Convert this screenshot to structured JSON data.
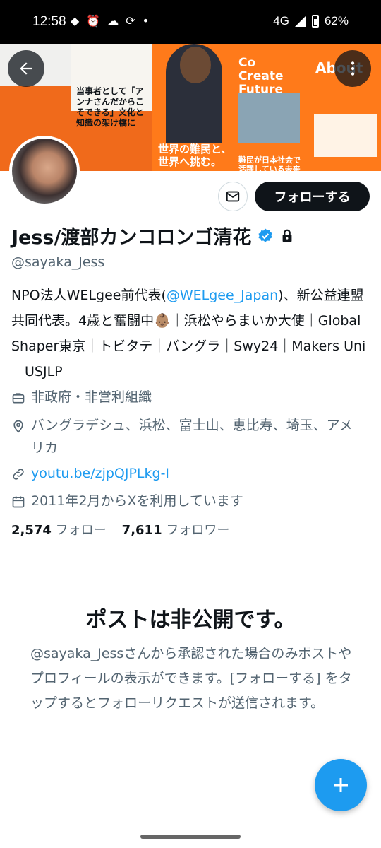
{
  "status_bar": {
    "time": "12:58",
    "network": "4G",
    "battery": "62%",
    "dot": "•"
  },
  "banner": {
    "text_1": "世界の難民と、世界へ挑む。",
    "text_2": "Co Create Future",
    "text_3": "About",
    "text_4": "難民が日本社会で活躍している未来へ",
    "text_5": "当事者として「アンナさんだからこそできる」文化と知識の架け橋に"
  },
  "profile": {
    "follow_label": "フォローする",
    "display_name": "Jess/渡部カンコロンゴ清花",
    "handle": "@sayaka_Jess",
    "bio_part1": "NPO法人WELgee前代表(",
    "bio_mention": "@WELgee_Japan",
    "bio_part2": ")、新公益連盟共同代表。4歳と奮闘中👶🏽｜浜松やらまいか大使｜Global Shaper東京｜トビタテ｜バングラ｜Swy24｜Makers Uni｜USJLP",
    "category": "非政府・非営利組織",
    "location": "バングラデシュ、浜松、富士山、恵比寿、埼玉、アメリカ",
    "link": "youtu.be/zjpQJPLkg-I",
    "joined": "2011年2月からXを利用しています",
    "following_count": "2,574",
    "following_label": "フォロー",
    "followers_count": "7,611",
    "followers_label": "フォロワー"
  },
  "private_notice": {
    "title": "ポストは非公開です。",
    "description": "@sayaka_Jessさんから承認された場合のみポストやプロフィールの表示ができます。[フォローする] をタップするとフォローリクエストが送信されます。"
  },
  "icons": [
    "back-arrow-icon",
    "more-vertical-icon",
    "mail-icon",
    "verified-badge-icon",
    "lock-icon",
    "briefcase-icon",
    "location-pin-icon",
    "link-icon",
    "calendar-icon",
    "plus-icon"
  ],
  "colors": {
    "accent": "#1d9bf0",
    "text_primary": "#0f1419",
    "text_secondary": "#536471",
    "banner_orange": "#ff7a1a"
  }
}
